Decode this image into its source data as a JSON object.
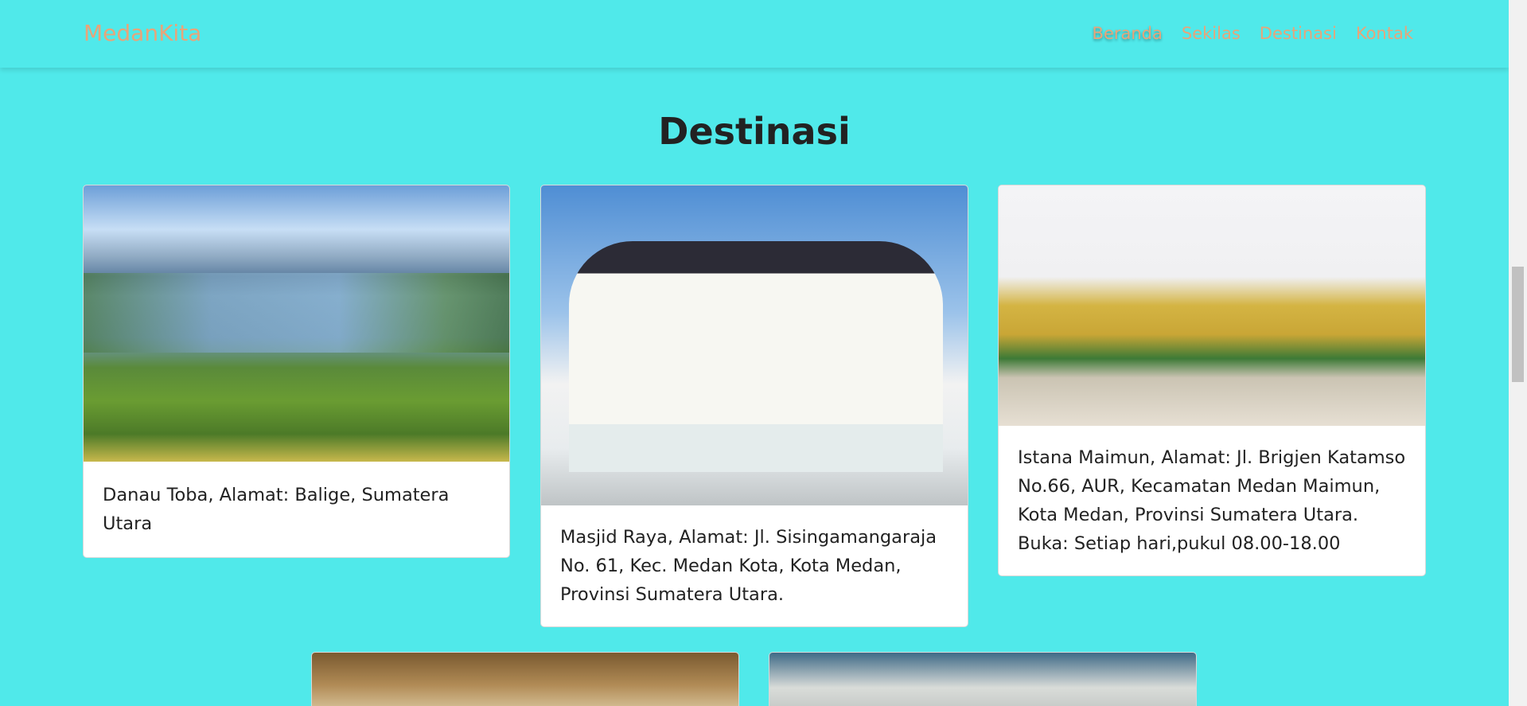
{
  "navbar": {
    "brand": "MedanKita",
    "links": [
      "Beranda",
      "Sekilas",
      "Destinasi",
      "Kontak"
    ]
  },
  "section": {
    "title": "Destinasi"
  },
  "cards": [
    {
      "image": "Danau Toba landscape photo",
      "lines": [
        "Danau Toba, Alamat: Balige, Sumatera Utara"
      ]
    },
    {
      "image": "Masjid Raya photo",
      "lines": [
        "Masjid Raya, Alamat: Jl. Sisingamangaraja No. 61, Kec. Medan Kota, Kota Medan, Provinsi Sumatera Utara."
      ]
    },
    {
      "image": "Istana Maimun photo",
      "lines": [
        "Istana Maimun, Alamat: Jl. Brigjen Katamso No.66, AUR, Kecamatan Medan Maimun, Kota Medan, Provinsi Sumatera Utara.",
        "Buka: Setiap hari,pukul 08.00-18.00"
      ]
    },
    {
      "image": "interior room photo",
      "lines": []
    },
    {
      "image": "cave photo",
      "lines": []
    }
  ],
  "colors": {
    "background": "#50e9ea",
    "nav_text": "#e7a57a",
    "card_background": "#ffffff"
  }
}
